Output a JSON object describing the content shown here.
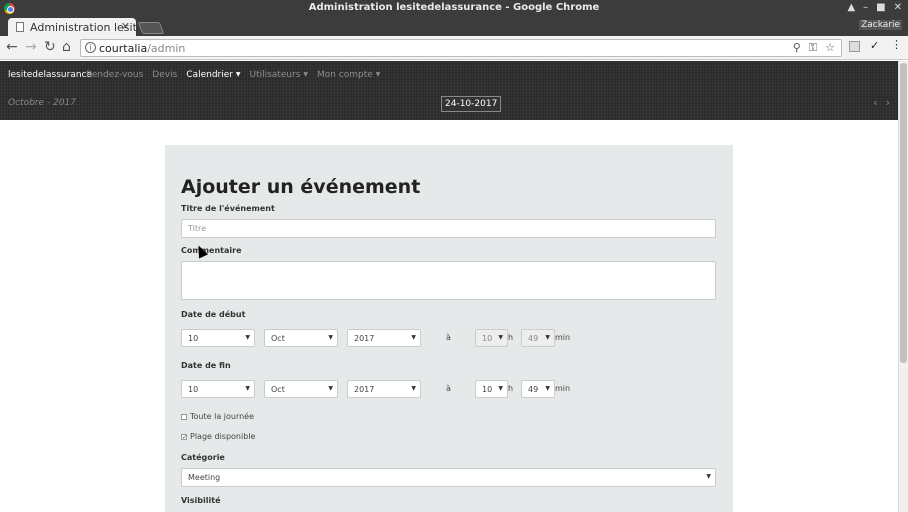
{
  "window": {
    "title": "Administration lesitedelassurance - Google Chrome",
    "controls": [
      "▲",
      "–",
      "■",
      "✕"
    ],
    "profile": "Zackarie"
  },
  "tab": {
    "title": "Administration lesit",
    "close": "✕"
  },
  "omnibox": {
    "host": "courtalia",
    "path": "/admin",
    "info": "i"
  },
  "nav": {
    "brand": "lesitedelassurance",
    "links": [
      "Rendez-vous",
      "Devis",
      "Calendrier",
      "Utilisateurs",
      "Mon compte"
    ],
    "active_index": 2,
    "month_label": "Octobre - 2017",
    "date_button": "24-10-2017",
    "prev": "‹",
    "next": "›"
  },
  "form": {
    "heading": "Ajouter un événement",
    "title_label": "Titre de l'événement",
    "title_placeholder": "Titre",
    "comment_label": "Commentaire",
    "start": {
      "label": "Date de début",
      "day": "10",
      "month": "Oct",
      "year": "2017",
      "at": "à",
      "hour": "10",
      "h": "h",
      "minute": "49",
      "min": "min"
    },
    "end": {
      "label": "Date de fin",
      "day": "10",
      "month": "Oct",
      "year": "2017",
      "at": "à",
      "hour": "10",
      "h": "h",
      "minute": "49",
      "min": "min"
    },
    "all_day": {
      "label": "Toute la journée",
      "checked": false
    },
    "available": {
      "label": "Plage disponible",
      "checked": true
    },
    "category_label": "Catégorie",
    "category_value": "Meeting",
    "visibility_label": "Visibilité"
  },
  "colors": {
    "navbar": "#2b2b2b",
    "panel": "#e6e9ea",
    "accent": "#ffffff"
  }
}
